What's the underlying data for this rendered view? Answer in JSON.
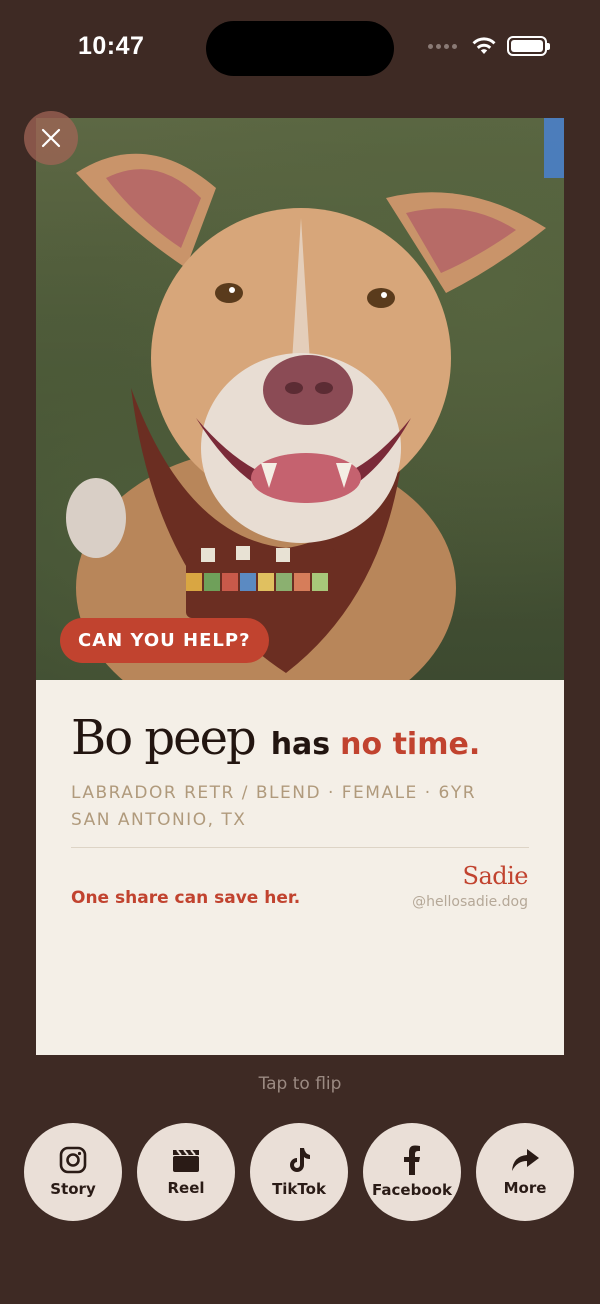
{
  "status_bar": {
    "time": "10:47"
  },
  "card": {
    "cta_label": "CAN YOU HELP?",
    "pet_name": "Bo peep",
    "has_word": "has",
    "urgency": "no time.",
    "breed_line": "LABRADOR RETR / BLEND · FEMALE · 6YR",
    "location": "SAN ANTONIO, TX",
    "save_message": "One share can save her.",
    "brand_name": "Sadie",
    "brand_handle": "@hellosadie.dog"
  },
  "flip_hint": "Tap to flip",
  "share_buttons": [
    {
      "label": "Story",
      "icon": "instagram-icon"
    },
    {
      "label": "Reel",
      "icon": "clapperboard-icon"
    },
    {
      "label": "TikTok",
      "icon": "tiktok-icon"
    },
    {
      "label": "Facebook",
      "icon": "facebook-icon"
    },
    {
      "label": "More",
      "icon": "share-arrow-icon"
    }
  ],
  "colors": {
    "background": "#3e2a24",
    "accent": "#c1432f",
    "card": "#f4efe7",
    "muted_text": "#b09a7c",
    "button": "#eadfd7"
  }
}
